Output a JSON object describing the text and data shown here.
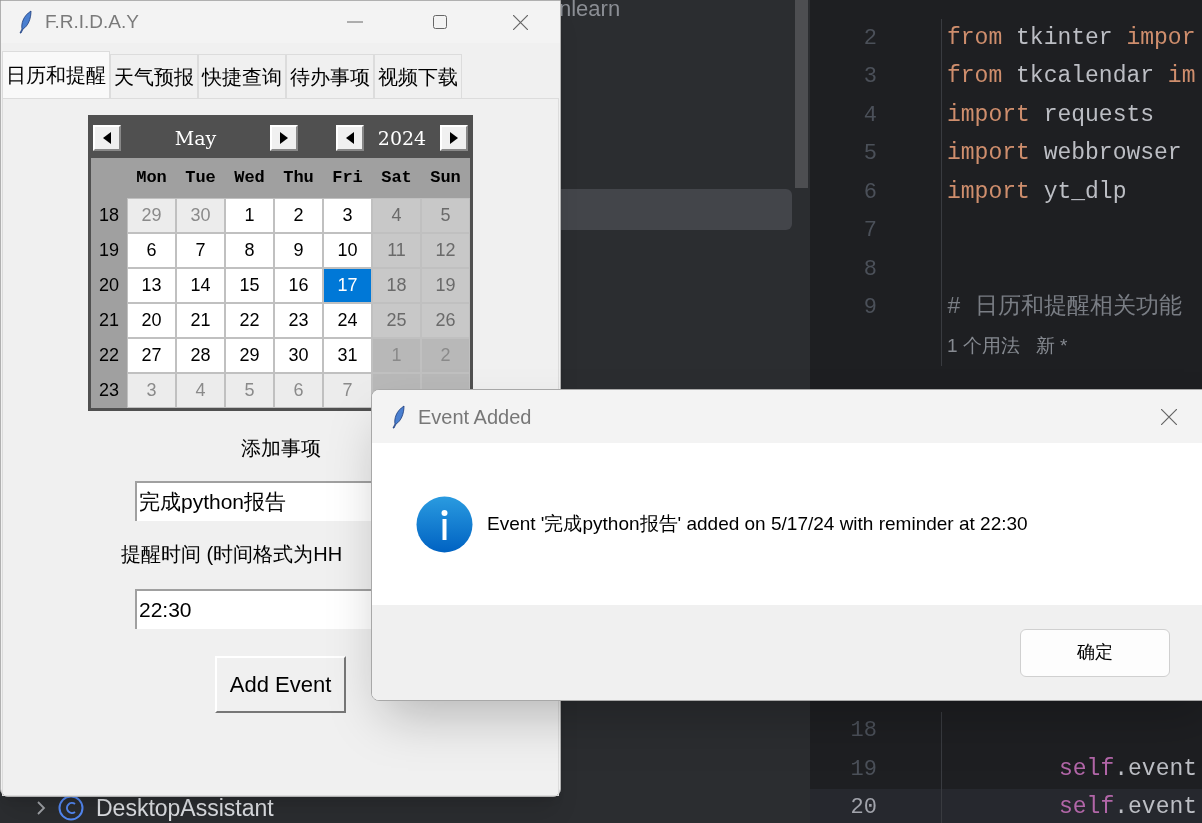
{
  "ide": {
    "project_tree": {
      "partial_item": "nlearn",
      "bottom_item": {
        "label": "DesktopAssistant",
        "expanded": false
      }
    },
    "editor": {
      "lines_top": [
        {
          "number": "2",
          "tokens": [
            {
              "text": "from",
              "kind": "keyword"
            },
            {
              "text": " tkinter ",
              "kind": "plain"
            },
            {
              "text": "impor",
              "kind": "keyword"
            }
          ]
        },
        {
          "number": "3",
          "tokens": [
            {
              "text": "from",
              "kind": "keyword"
            },
            {
              "text": " tkcalendar ",
              "kind": "plain"
            },
            {
              "text": "im",
              "kind": "keyword"
            }
          ]
        },
        {
          "number": "4",
          "tokens": [
            {
              "text": "import",
              "kind": "keyword"
            },
            {
              "text": " requests",
              "kind": "plain"
            }
          ]
        },
        {
          "number": "5",
          "tokens": [
            {
              "text": "import",
              "kind": "keyword"
            },
            {
              "text": " webbrowser",
              "kind": "plain"
            }
          ]
        },
        {
          "number": "6",
          "tokens": [
            {
              "text": "import",
              "kind": "keyword"
            },
            {
              "text": " yt_dlp",
              "kind": "plain"
            }
          ]
        },
        {
          "number": "7"
        },
        {
          "number": "8"
        },
        {
          "number": "9",
          "tokens": [
            {
              "text": "# 日历和提醒相关功能",
              "kind": "comment"
            }
          ]
        },
        {
          "tokens": [
            {
              "text": "1 个用法   新 *",
              "kind": "hint"
            }
          ]
        }
      ],
      "lines_bottom": [
        {
          "number": "18"
        },
        {
          "number": "19",
          "kind": "nested",
          "tokens": [
            {
              "text": "self",
              "kind": "self"
            },
            {
              "text": ".event",
              "kind": "plain"
            }
          ]
        },
        {
          "number": "20",
          "kind": "nested",
          "current": true,
          "tokens": [
            {
              "text": "self",
              "kind": "self"
            },
            {
              "text": ".event",
              "kind": "plain"
            }
          ]
        }
      ]
    }
  },
  "main_window": {
    "title": "F.R.I.D.A.Y",
    "tabs": [
      {
        "label": "日历和提醒",
        "selected": true
      },
      {
        "label": "天气预报",
        "selected": false
      },
      {
        "label": "快捷查询",
        "selected": false
      },
      {
        "label": "待办事项",
        "selected": false
      },
      {
        "label": "视频下载",
        "selected": false
      }
    ],
    "calendar": {
      "month": "May",
      "year": "2024",
      "weekdays": [
        "Mon",
        "Tue",
        "Wed",
        "Thu",
        "Fri",
        "Sat",
        "Sun"
      ],
      "weeks": [
        {
          "number": "18",
          "days": [
            {
              "label": "29",
              "kind": "other",
              "selected": false
            },
            {
              "label": "30",
              "kind": "other",
              "selected": false
            },
            {
              "label": "1",
              "kind": "weekday",
              "selected": false
            },
            {
              "label": "2",
              "kind": "weekday",
              "selected": false
            },
            {
              "label": "3",
              "kind": "weekday",
              "selected": false
            },
            {
              "label": "4",
              "kind": "weekend",
              "selected": false
            },
            {
              "label": "5",
              "kind": "weekend",
              "selected": false
            }
          ]
        },
        {
          "number": "19",
          "days": [
            {
              "label": "6",
              "kind": "weekday",
              "selected": false
            },
            {
              "label": "7",
              "kind": "weekday",
              "selected": false
            },
            {
              "label": "8",
              "kind": "weekday",
              "selected": false
            },
            {
              "label": "9",
              "kind": "weekday",
              "selected": false
            },
            {
              "label": "10",
              "kind": "weekday",
              "selected": false
            },
            {
              "label": "11",
              "kind": "weekend",
              "selected": false
            },
            {
              "label": "12",
              "kind": "weekend",
              "selected": false
            }
          ]
        },
        {
          "number": "20",
          "days": [
            {
              "label": "13",
              "kind": "weekday",
              "selected": false
            },
            {
              "label": "14",
              "kind": "weekday",
              "selected": false
            },
            {
              "label": "15",
              "kind": "weekday",
              "selected": false
            },
            {
              "label": "16",
              "kind": "weekday",
              "selected": false
            },
            {
              "label": "17",
              "kind": "weekday",
              "selected": true
            },
            {
              "label": "18",
              "kind": "weekend",
              "selected": false
            },
            {
              "label": "19",
              "kind": "weekend",
              "selected": false
            }
          ]
        },
        {
          "number": "21",
          "days": [
            {
              "label": "20",
              "kind": "weekday",
              "selected": false
            },
            {
              "label": "21",
              "kind": "weekday",
              "selected": false
            },
            {
              "label": "22",
              "kind": "weekday",
              "selected": false
            },
            {
              "label": "23",
              "kind": "weekday",
              "selected": false
            },
            {
              "label": "24",
              "kind": "weekday",
              "selected": false
            },
            {
              "label": "25",
              "kind": "weekend",
              "selected": false
            },
            {
              "label": "26",
              "kind": "weekend",
              "selected": false
            }
          ]
        },
        {
          "number": "22",
          "days": [
            {
              "label": "27",
              "kind": "weekday",
              "selected": false
            },
            {
              "label": "28",
              "kind": "weekday",
              "selected": false
            },
            {
              "label": "29",
              "kind": "weekday",
              "selected": false
            },
            {
              "label": "30",
              "kind": "weekday",
              "selected": false
            },
            {
              "label": "31",
              "kind": "weekday",
              "selected": false
            },
            {
              "label": "1",
              "kind": "other_weekend",
              "selected": false
            },
            {
              "label": "2",
              "kind": "other_weekend",
              "selected": false
            }
          ]
        },
        {
          "number": "23",
          "days": [
            {
              "label": "3",
              "kind": "other",
              "selected": false
            },
            {
              "label": "4",
              "kind": "other",
              "selected": false
            },
            {
              "label": "5",
              "kind": "other",
              "selected": false
            },
            {
              "label": "6",
              "kind": "other",
              "selected": false
            },
            {
              "label": "7",
              "kind": "other",
              "selected": false
            }
          ]
        }
      ]
    },
    "event_label": "添加事项",
    "event_value": "完成python报告",
    "time_label": "提醒时间 (时间格式为HH",
    "time_value": "22:30",
    "add_button": "Add Event"
  },
  "dialog": {
    "title": "Event Added",
    "message": "Event '完成python报告' added on 5/17/24 with reminder at 22:30",
    "ok_button": "确定"
  }
}
